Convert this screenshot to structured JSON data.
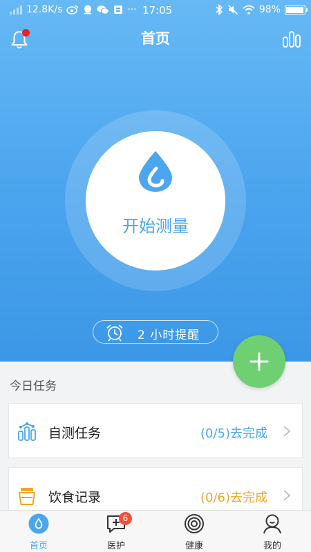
{
  "status_bar": {
    "net_speed": "12.8K/s",
    "time": "17:05",
    "more": "···",
    "battery": "98%",
    "battery_level": 0.98
  },
  "header": {
    "title": "首页",
    "bell_icon": "bell-icon",
    "stats_icon": "bar-chart-icon"
  },
  "measure": {
    "label": "开始测量",
    "icon": "water-drop-icon"
  },
  "reminder": {
    "label": "2 小时提醒",
    "icon": "alarm-clock-icon"
  },
  "fab": {
    "icon": "plus-icon"
  },
  "tasks": {
    "section_title": "今日任务",
    "items": [
      {
        "name": "自测任务",
        "status": "(0/5)去完成",
        "icon": "bar-chart-icon",
        "color": "#4aa6ee"
      },
      {
        "name": "饮食记录",
        "status": "(0/6)去完成",
        "icon": "cup-icon",
        "color": "#f0a52a"
      }
    ]
  },
  "bottom_nav": {
    "items": [
      {
        "label": "首页",
        "icon": "water-drop-icon",
        "active": true
      },
      {
        "label": "医护",
        "icon": "medical-chat-icon",
        "badge": "6"
      },
      {
        "label": "健康",
        "icon": "concentric-circles-icon"
      },
      {
        "label": "我的",
        "icon": "person-icon"
      }
    ]
  },
  "colors": {
    "primary": "#4aa6ee",
    "fab": "#6fcf73",
    "alert": "#e8202a",
    "badge": "#f0503c"
  }
}
